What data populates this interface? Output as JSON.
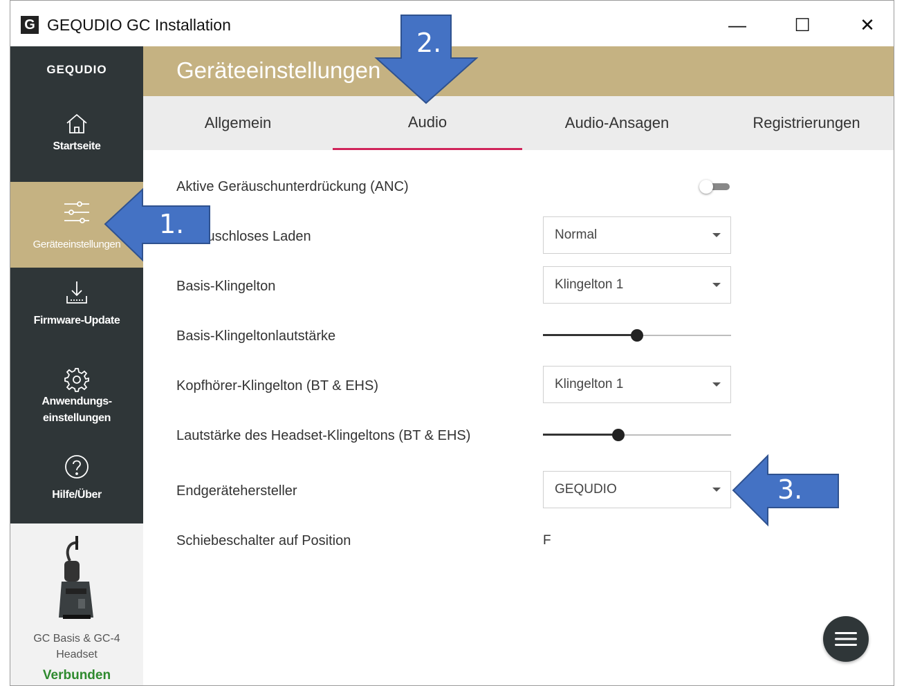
{
  "window": {
    "app_icon_letter": "G",
    "title": "GEQUDIO GC Installation",
    "minimize_glyph": "—",
    "maximize_glyph": "☐",
    "close_glyph": "✕"
  },
  "sidebar": {
    "brand": "GEQUDIO",
    "items": [
      {
        "label": "Startseite",
        "icon": "home-icon"
      },
      {
        "label": "Geräteeinstellungen",
        "icon": "sliders-icon",
        "active": true
      },
      {
        "label": "Firmware-Update",
        "icon": "download-icon"
      },
      {
        "label_line1": "Anwendungs-",
        "label_line2": "einstellungen",
        "icon": "gear-icon"
      },
      {
        "label": "Hilfe/Über",
        "icon": "help-icon"
      }
    ],
    "device": {
      "name_line1": "GC Basis & GC-4",
      "name_line2": "Headset",
      "status": "Verbunden"
    }
  },
  "header": {
    "title": "Geräteeinstellungen"
  },
  "tabs": [
    {
      "label": "Allgemein"
    },
    {
      "label": "Audio",
      "active": true
    },
    {
      "label": "Audio-Ansagen"
    },
    {
      "label": "Registrierungen"
    }
  ],
  "settings": {
    "anc": {
      "label": "Aktive Geräuschunterdrückung (ANC)",
      "enabled": false
    },
    "silent_charging": {
      "label": "Geräuschloses Laden",
      "value": "Normal"
    },
    "base_ringtone": {
      "label": "Basis-Klingelton",
      "value": "Klingelton 1"
    },
    "base_ringtone_volume": {
      "label": "Basis-Klingeltonlautstärke",
      "level": 0.5
    },
    "headset_ringtone": {
      "label": "Kopfhörer-Klingelton (BT & EHS)",
      "value": "Klingelton 1"
    },
    "headset_ringtone_volume": {
      "label": "Lautstärke des Headset-Klingeltons (BT & EHS)",
      "level": 0.4
    },
    "device_manufacturer": {
      "label": "Endgerätehersteller",
      "value": "GEQUDIO"
    },
    "slide_switch": {
      "label": "Schiebeschalter auf Position",
      "value": "F"
    }
  },
  "annotations": {
    "step1": "1.",
    "step2": "2.",
    "step3": "3.",
    "arrow_color": "#4472c4"
  },
  "colors": {
    "accent_gold": "#c5b282",
    "sidebar_dark": "#2f3638",
    "tab_underline": "#d0245a",
    "status_green": "#2e8a2e"
  }
}
